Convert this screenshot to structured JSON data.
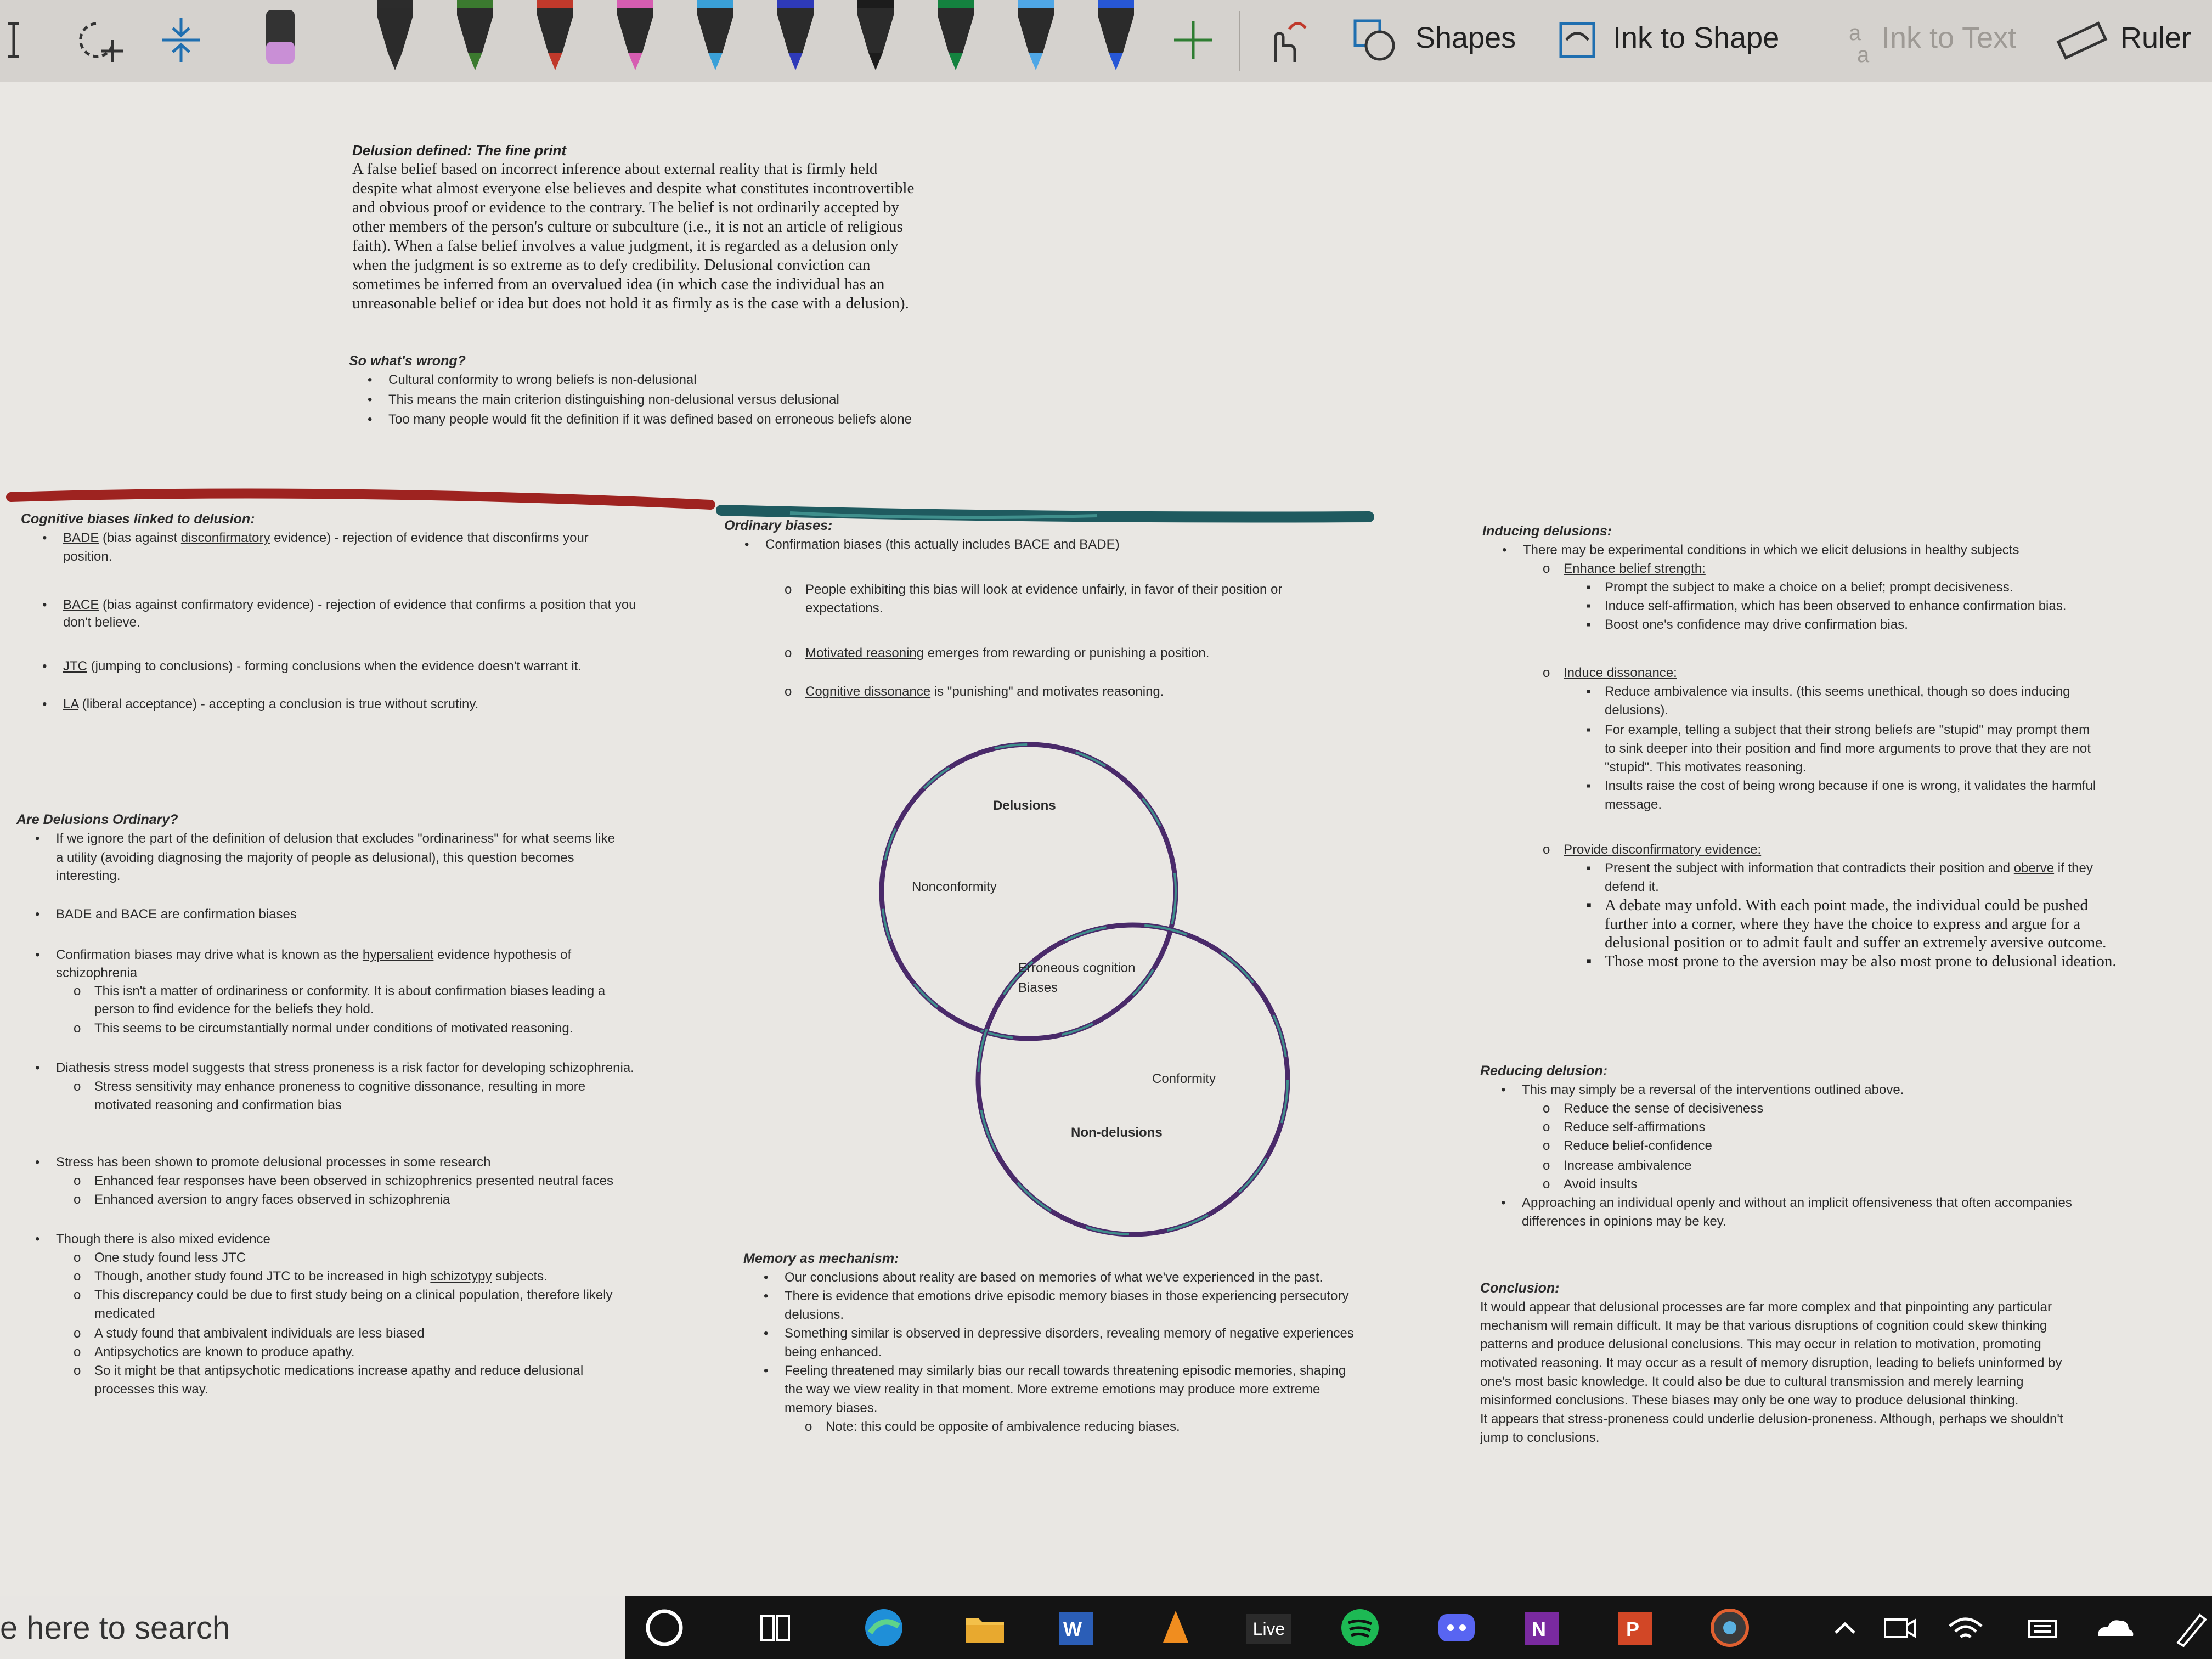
{
  "toolbar": {
    "shapes_label": "Shapes",
    "ink_to_shape_label": "Ink to Shape",
    "ink_to_text_label": "Ink to Text",
    "ruler_label": "Ruler",
    "pen_colors": [
      "#2c2c2c",
      "#3b7a2f",
      "#c0392b",
      "#d65db1",
      "#3aa0d8",
      "#2e3ab8",
      "#1c1c1c",
      "#14823f",
      "#4fa7e6",
      "#2757d6"
    ]
  },
  "definition": {
    "heading": "Delusion defined: The fine print",
    "lines": [
      "A false belief based on incorrect inference about external reality that is firmly held",
      "despite what almost everyone else believes and despite what constitutes incontrovertible",
      "and obvious proof or evidence to the contrary. The belief is not ordinarily accepted by",
      "other members of the person's culture or subculture (i.e., it is not an article of religious",
      "faith). When a false belief involves a value judgment, it is regarded as a delusion only",
      "when the judgment is so extreme as to defy credibility. Delusional conviction can",
      "sometimes be inferred from an overvalued idea (in which case the individual has an",
      "unreasonable belief or idea but does not hold it as firmly as is the case with a delusion)."
    ]
  },
  "whats_wrong": {
    "heading": "So what's wrong?",
    "bullets": [
      "Cultural conformity to wrong beliefs is non-delusional",
      "This means the main criterion distinguishing non-delusional versus delusional",
      "Too many people would fit the definition if it was defined based on erroneous beliefs alone"
    ]
  },
  "cognitive_biases": {
    "heading": "Cognitive biases linked to delusion:",
    "bade_term": "BADE",
    "bade_a": " (bias against ",
    "bade_b": "disconfirmatory",
    "bade_c": " evidence) - rejection of evidence that disconfirms your",
    "bade_2": "position.",
    "bace_term": "BACE",
    "bace_1": " (bias against confirmatory evidence) - rejection of evidence that confirms a position that you",
    "bace_2": "don't believe.",
    "jtc_term": "JTC",
    "jtc_1": " (jumping to conclusions) - forming conclusions when the evidence doesn't warrant it.",
    "la_term": "LA",
    "la_1": " (liberal acceptance) - accepting a conclusion is true without scrutiny."
  },
  "ordinary": {
    "heading": "Are Delusions Ordinary?",
    "l1": "If we ignore the part of the definition of delusion that excludes \"ordinariness\" for what seems like",
    "l2": "a utility (avoiding diagnosing the majority of people as delusional), this question becomes",
    "l3": "interesting.",
    "l4": "BADE and BACE are confirmation biases",
    "l5a": "Confirmation biases may drive what is known as the ",
    "l5b": "hypersalient",
    "l5c": " evidence hypothesis of",
    "l6": "schizophrenia",
    "l7": "This isn't a matter of ordinariness or conformity. It is about confirmation biases leading a",
    "l8": "person to find evidence for the beliefs they hold.",
    "l9": "This seems to be circumstantially normal under conditions of motivated reasoning.",
    "l10": "Diathesis stress model suggests that stress proneness is a risk factor for developing schizophrenia.",
    "l11": "Stress sensitivity may enhance proneness to cognitive dissonance, resulting in more",
    "l12": "motivated reasoning and confirmation bias",
    "l13": "Stress has been shown to promote delusional processes in some research",
    "l14": "Enhanced fear responses have been observed in schizophrenics presented neutral faces",
    "l15": "Enhanced aversion to angry faces observed in schizophrenia",
    "l16": "Though there is also mixed evidence",
    "l17": "One study found less JTC",
    "l18a": "Though, another study found JTC to be increased in high ",
    "l18b": "schizotypy",
    "l18c": " subjects.",
    "l19": "This discrepancy could be due to first study being on a clinical population, therefore likely",
    "l20": "medicated",
    "l21": "A study found that ambivalent individuals are less biased",
    "l22": "Antipsychotics are known to produce apathy.",
    "l23": "So it might be that antipsychotic medications increase apathy and reduce delusional",
    "l24": "processes this way."
  },
  "ordinary_biases": {
    "heading": "Ordinary biases:",
    "l1": "Confirmation biases (this actually includes BACE and BADE)",
    "l2": "People exhibiting this bias will look at evidence unfairly, in favor of their position or",
    "l3": "expectations.",
    "l4a": "Motivated reasoning",
    "l4b": " emerges from rewarding or punishing a position.",
    "l5a": "Cognitive dissonance",
    "l5b": " is \"punishing\" and motivates reasoning."
  },
  "venn": {
    "delusions": "Delusions",
    "nonconformity": "Nonconformity",
    "erroneous": "Erroneous cognition",
    "biases": "Biases",
    "conformity": "Conformity",
    "non_delusions": "Non-delusions"
  },
  "memory": {
    "heading": "Memory as  mechanism:",
    "l1": "Our conclusions about reality are based on memories of what we've experienced in the past.",
    "l2": "There is evidence that emotions drive episodic memory biases in those experiencing persecutory",
    "l3": "delusions.",
    "l4": "Something similar is observed in depressive disorders, revealing memory of negative experiences",
    "l5": "being enhanced.",
    "l6": "Feeling threatened may similarly bias our recall towards threatening episodic memories, shaping",
    "l7": "the way we view reality in that moment. More extreme emotions may produce more extreme",
    "l8": "memory biases.",
    "l9": "Note: this could be opposite of ambivalence reducing biases."
  },
  "inducing": {
    "heading": "Inducing delusions:",
    "l1": "There may be experimental conditions in which we elicit delusions in healthy subjects",
    "l2": "Enhance belief strength:",
    "l3": "Prompt the subject to make a choice on a belief; prompt decisiveness.",
    "l4": "Induce self-affirmation, which has been observed to enhance confirmation bias.",
    "l5": "Boost one's confidence may drive confirmation bias.",
    "l6": "Induce dissonance:",
    "l7": "Reduce ambivalence via insults. (this seems unethical, though so does inducing",
    "l8": "delusions).",
    "l9": "For example, telling a subject that their strong beliefs are \"stupid\" may prompt them",
    "l10": "to sink deeper into their position and find more arguments to prove that they are not",
    "l11": "\"stupid\". This motivates reasoning.",
    "l12": "Insults raise the cost of being wrong because if one is wrong, it validates the harmful",
    "l13": "message.",
    "l14": "Provide disconfirmatory evidence:",
    "l15a": "Present the subject with information that contradicts their position and ",
    "l15b": "oberve",
    "l15c": " if they",
    "l16": "defend it.",
    "l17": "A debate may unfold. With each point made, the individual could be pushed",
    "l18": "further into a corner, where they have the choice to express and argue for a",
    "l19": "delusional position or to admit fault and suffer an extremely aversive outcome.",
    "l20": "Those most prone to the aversion may be also most prone to delusional ideation."
  },
  "reducing": {
    "heading": "Reducing delusion:",
    "l1": "This may simply be a reversal of the interventions outlined above.",
    "l2": "Reduce the sense of decisiveness",
    "l3": "Reduce self-affirmations",
    "l4": "Reduce belief-confidence",
    "l5": "Increase ambivalence",
    "l6": "Avoid insults",
    "l7": "Approaching an individual openly and without an implicit offensiveness that often accompanies",
    "l8": "differences in opinions may be key."
  },
  "conclusion": {
    "heading": "Conclusion:",
    "lines": [
      "It would appear that delusional processes are far more complex and that pinpointing any particular",
      "mechanism will remain difficult. It may be that various disruptions of cognition could skew thinking",
      "patterns and produce delusional conclusions. This may occur in relation to motivation, promoting",
      "motivated reasoning. It may occur as a result of memory disruption, leading to beliefs uninformed by",
      "one's most basic knowledge. It could also be due to cultural transmission and merely learning",
      "misinformed conclusions. These biases may only be one way to produce delusional thinking.",
      "It appears that stress-proneness could underlie delusion-proneness. Although, perhaps we shouldn't",
      "jump to conclusions."
    ]
  },
  "taskbar": {
    "search_text": "e here to search",
    "live_label": "Live",
    "word_letter": "W",
    "onenote_letter": "N",
    "ppt_letter": "P"
  }
}
